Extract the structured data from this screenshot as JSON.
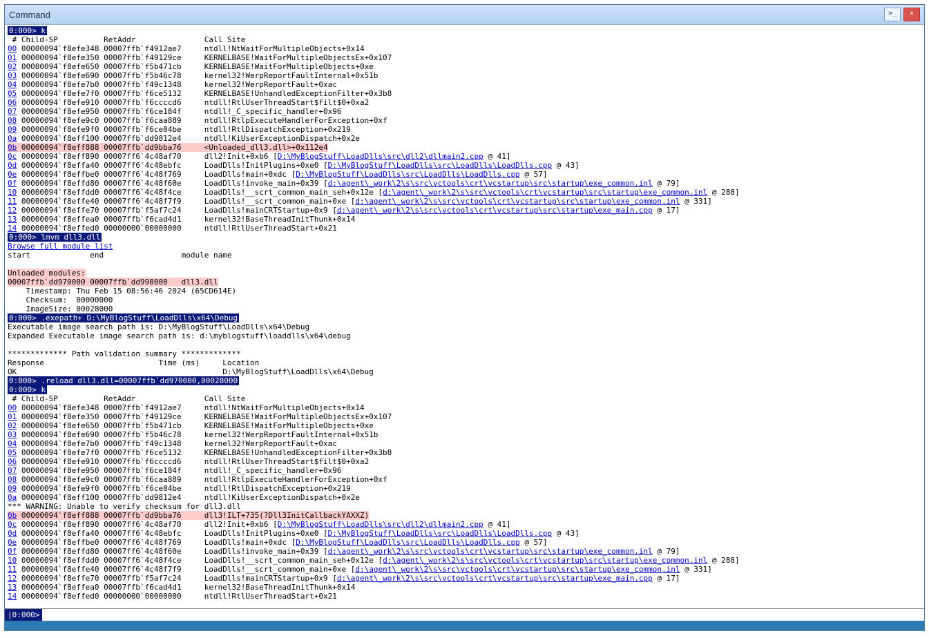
{
  "title": "Command",
  "prompts": {
    "p0000": "0:000>",
    "cmd_k": "k",
    "cmd_lmvm": "lmvm dll3.dll",
    "cmd_browse": "Browse full module list",
    "cmd_exepath": ".exepath+ D:\\MyBlogStuff\\LoadDlls\\x64\\Debug",
    "cmd_reload": ".reload dll3.dll=00007ffb`dd970000,00028000"
  },
  "header": " # Child-SP          RetAddr               Call Site",
  "lm_header": "start             end                 module name",
  "stack1": [
    {
      "n": "00",
      "sp": "00000094`f8efe348",
      "ret": "00007ffb`f4912ae7",
      "site": "ntdll!NtWaitForMultipleObjects+0x14"
    },
    {
      "n": "01",
      "sp": "00000094`f8efe350",
      "ret": "00007ffb`f49129ce",
      "site": "KERNELBASE!WaitForMultipleObjectsEx+0x107"
    },
    {
      "n": "02",
      "sp": "00000094`f8efe650",
      "ret": "00007ffb`f5b471cb",
      "site": "KERNELBASE!WaitForMultipleObjects+0xe"
    },
    {
      "n": "03",
      "sp": "00000094`f8efe690",
      "ret": "00007ffb`f5b46c78",
      "site": "kernel32!WerpReportFaultInternal+0x51b"
    },
    {
      "n": "04",
      "sp": "00000094`f8efe7b0",
      "ret": "00007ffb`f49c1348",
      "site": "kernel32!WerpReportFault+0xac"
    },
    {
      "n": "05",
      "sp": "00000094`f8efe7f0",
      "ret": "00007ffb`f6ce5132",
      "site": "KERNELBASE!UnhandledExceptionFilter+0x3b8"
    },
    {
      "n": "06",
      "sp": "00000094`f8efe910",
      "ret": "00007ffb`f6ccccd6",
      "site": "ntdll!RtlUserThreadStart$filt$0+0xa2"
    },
    {
      "n": "07",
      "sp": "00000094`f8efe950",
      "ret": "00007ffb`f6ce184f",
      "site": "ntdll!_C_specific_handler+0x96"
    },
    {
      "n": "08",
      "sp": "00000094`f8efe9c0",
      "ret": "00007ffb`f6caa889",
      "site": "ntdll!RtlpExecuteHandlerForException+0xf"
    },
    {
      "n": "09",
      "sp": "00000094`f8efe9f0",
      "ret": "00007ffb`f6ce04be",
      "site": "ntdll!RtlDispatchException+0x219"
    },
    {
      "n": "0a",
      "sp": "00000094`f8eff100",
      "ret": "00007ffb`dd9812e4",
      "site": "ntdll!KiUserExceptionDispatch+0x2e"
    }
  ],
  "stack1_hl": {
    "n": "0b",
    "sp": "00000094`f8eff888",
    "ret": "00007ffb`dd9bba76",
    "site": "<Unloaded_dll3.dll>+0x112e4"
  },
  "stack1_rest": [
    {
      "n": "0c",
      "sp": "00000094`f8eff890",
      "ret": "00007ff6`4c48af70",
      "pre": "dll2!Init+0xb6 [",
      "lnk": "D:\\MyBlogStuff\\LoadDlls\\src\\dll2\\dllmain2.cpp",
      "post": " @ 41]"
    },
    {
      "n": "0d",
      "sp": "00000094`f8effa40",
      "ret": "00007ff6`4c48ebfc",
      "pre": "LoadDlls!InitPlugins+0xe0 [",
      "lnk": "D:\\MyBlogStuff\\LoadDlls\\src\\LoadDlls\\LoadDlls.cpp",
      "post": " @ 43]"
    },
    {
      "n": "0e",
      "sp": "00000094`f8effbe0",
      "ret": "00007ff6`4c48f769",
      "pre": "LoadDlls!main+0xdc [",
      "lnk": "D:\\MyBlogStuff\\LoadDlls\\src\\LoadDlls\\LoadDlls.cpp",
      "post": " @ 57]"
    },
    {
      "n": "0f",
      "sp": "00000094`f8effd80",
      "ret": "00007ff6`4c48f60e",
      "pre": "LoadDlls!invoke_main+0x39 [",
      "lnk": "d:\\agent\\_work\\2\\s\\src\\vctools\\crt\\vcstartup\\src\\startup\\exe_common.inl",
      "post": " @ 79]"
    },
    {
      "n": "10",
      "sp": "00000094`f8effdd0",
      "ret": "00007ff6`4c48f4ce",
      "pre": "LoadDlls!__scrt_common_main_seh+0x12e [",
      "lnk": "d:\\agent\\_work\\2\\s\\src\\vctools\\crt\\vcstartup\\src\\startup\\exe_common.inl",
      "post": " @ 288]"
    },
    {
      "n": "11",
      "sp": "00000094`f8effe40",
      "ret": "00007ff6`4c48f7f9",
      "pre": "LoadDlls!__scrt_common_main+0xe [",
      "lnk": "d:\\agent\\_work\\2\\s\\src\\vctools\\crt\\vcstartup\\src\\startup\\exe_common.inl",
      "post": " @ 331]"
    },
    {
      "n": "12",
      "sp": "00000094`f8effe70",
      "ret": "00007ffb`f5af7c24",
      "pre": "LoadDlls!mainCRTStartup+0x9 [",
      "lnk": "d:\\agent\\_work\\2\\s\\src\\vctools\\crt\\vcstartup\\src\\startup\\exe_main.cpp",
      "post": " @ 17]"
    },
    {
      "n": "13",
      "sp": "00000094`f8effea0",
      "ret": "00007ffb`f6cad4d1",
      "site": "kernel32!BaseThreadInitThunk+0x14"
    },
    {
      "n": "14",
      "sp": "00000094`f8effed0",
      "ret": "00000000`00000000",
      "site": "ntdll!RtlUserThreadStart+0x21"
    }
  ],
  "unloaded": {
    "heading": "Unloaded modules:",
    "range": "00007ffb`dd970000 00007ffb`dd998000   dll3.dll",
    "timestamp": "    Timestamp: Thu Feb 15 08:56:46 2024 (65CD614E)",
    "checksum": "    Checksum:  00000000",
    "imagesize": "    ImageSize: 00028000"
  },
  "exepath_out": [
    "Executable image search path is: D:\\MyBlogStuff\\LoadDlls\\x64\\Debug",
    "Expanded Executable image search path is: d:\\myblogstuff\\loaddlls\\x64\\debug",
    "",
    "************* Path validation summary *************",
    "Response                         Time (ms)     Location",
    "OK                                             D:\\MyBlogStuff\\LoadDlls\\x64\\Debug"
  ],
  "warn": "*** WARNING: Unable to verify checksum for dll3.dll",
  "stack2_hl": {
    "n": "0b",
    "sp": "00000094`f8eff888",
    "ret": "00007ffb`dd9bba76",
    "site": "dll3!ILT+735(?Dll3InitCallbackYAXXZ)"
  },
  "input_prompt": "|0:000>"
}
